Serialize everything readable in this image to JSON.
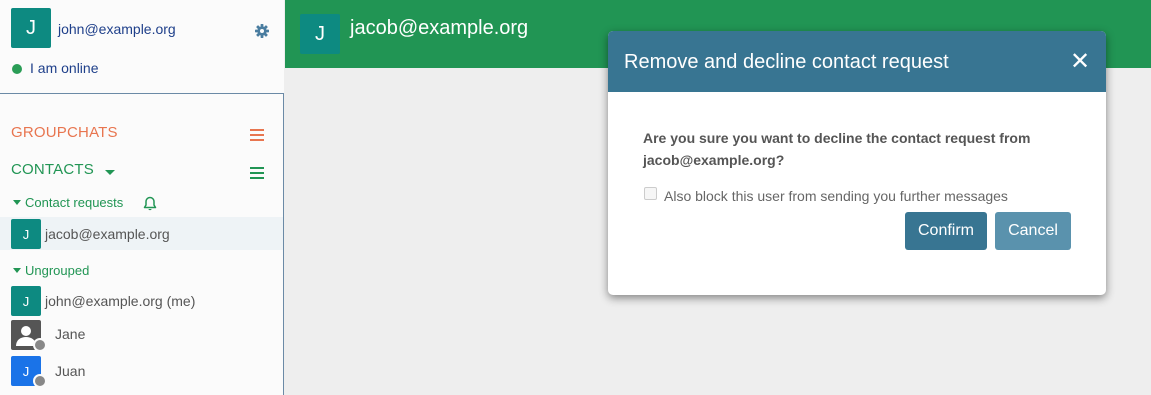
{
  "profile": {
    "avatar_letter": "J",
    "jid": "john@example.org",
    "status": "I am online",
    "avatar_color": "#0d8a81"
  },
  "sidebar": {
    "groupchats_label": "GROUPCHATS",
    "contacts_label": "CONTACTS",
    "contact_requests_label": "Contact requests",
    "ungrouped_label": "Ungrouped",
    "requests": [
      {
        "letter": "J",
        "name": "jacob@example.org",
        "color": "#0d8a81"
      }
    ],
    "ungrouped": [
      {
        "letter": "J",
        "name": "john@example.org (me)",
        "color": "#0d8a81"
      },
      {
        "letter": "",
        "name": "Jane",
        "icon": "user-icon"
      },
      {
        "letter": "J",
        "name": "Juan",
        "color": "#1a73e8"
      }
    ]
  },
  "chat": {
    "avatar_letter": "J",
    "title": "jacob@example.org",
    "header_color": "#219554"
  },
  "modal": {
    "title": "Remove and decline contact request",
    "close_glyph": "✕",
    "question": "Are you sure you want to decline the contact request from jacob@example.org?",
    "block_label": "Also block this user from sending you further messages",
    "confirm_label": "Confirm",
    "cancel_label": "Cancel",
    "header_color": "#387592"
  }
}
